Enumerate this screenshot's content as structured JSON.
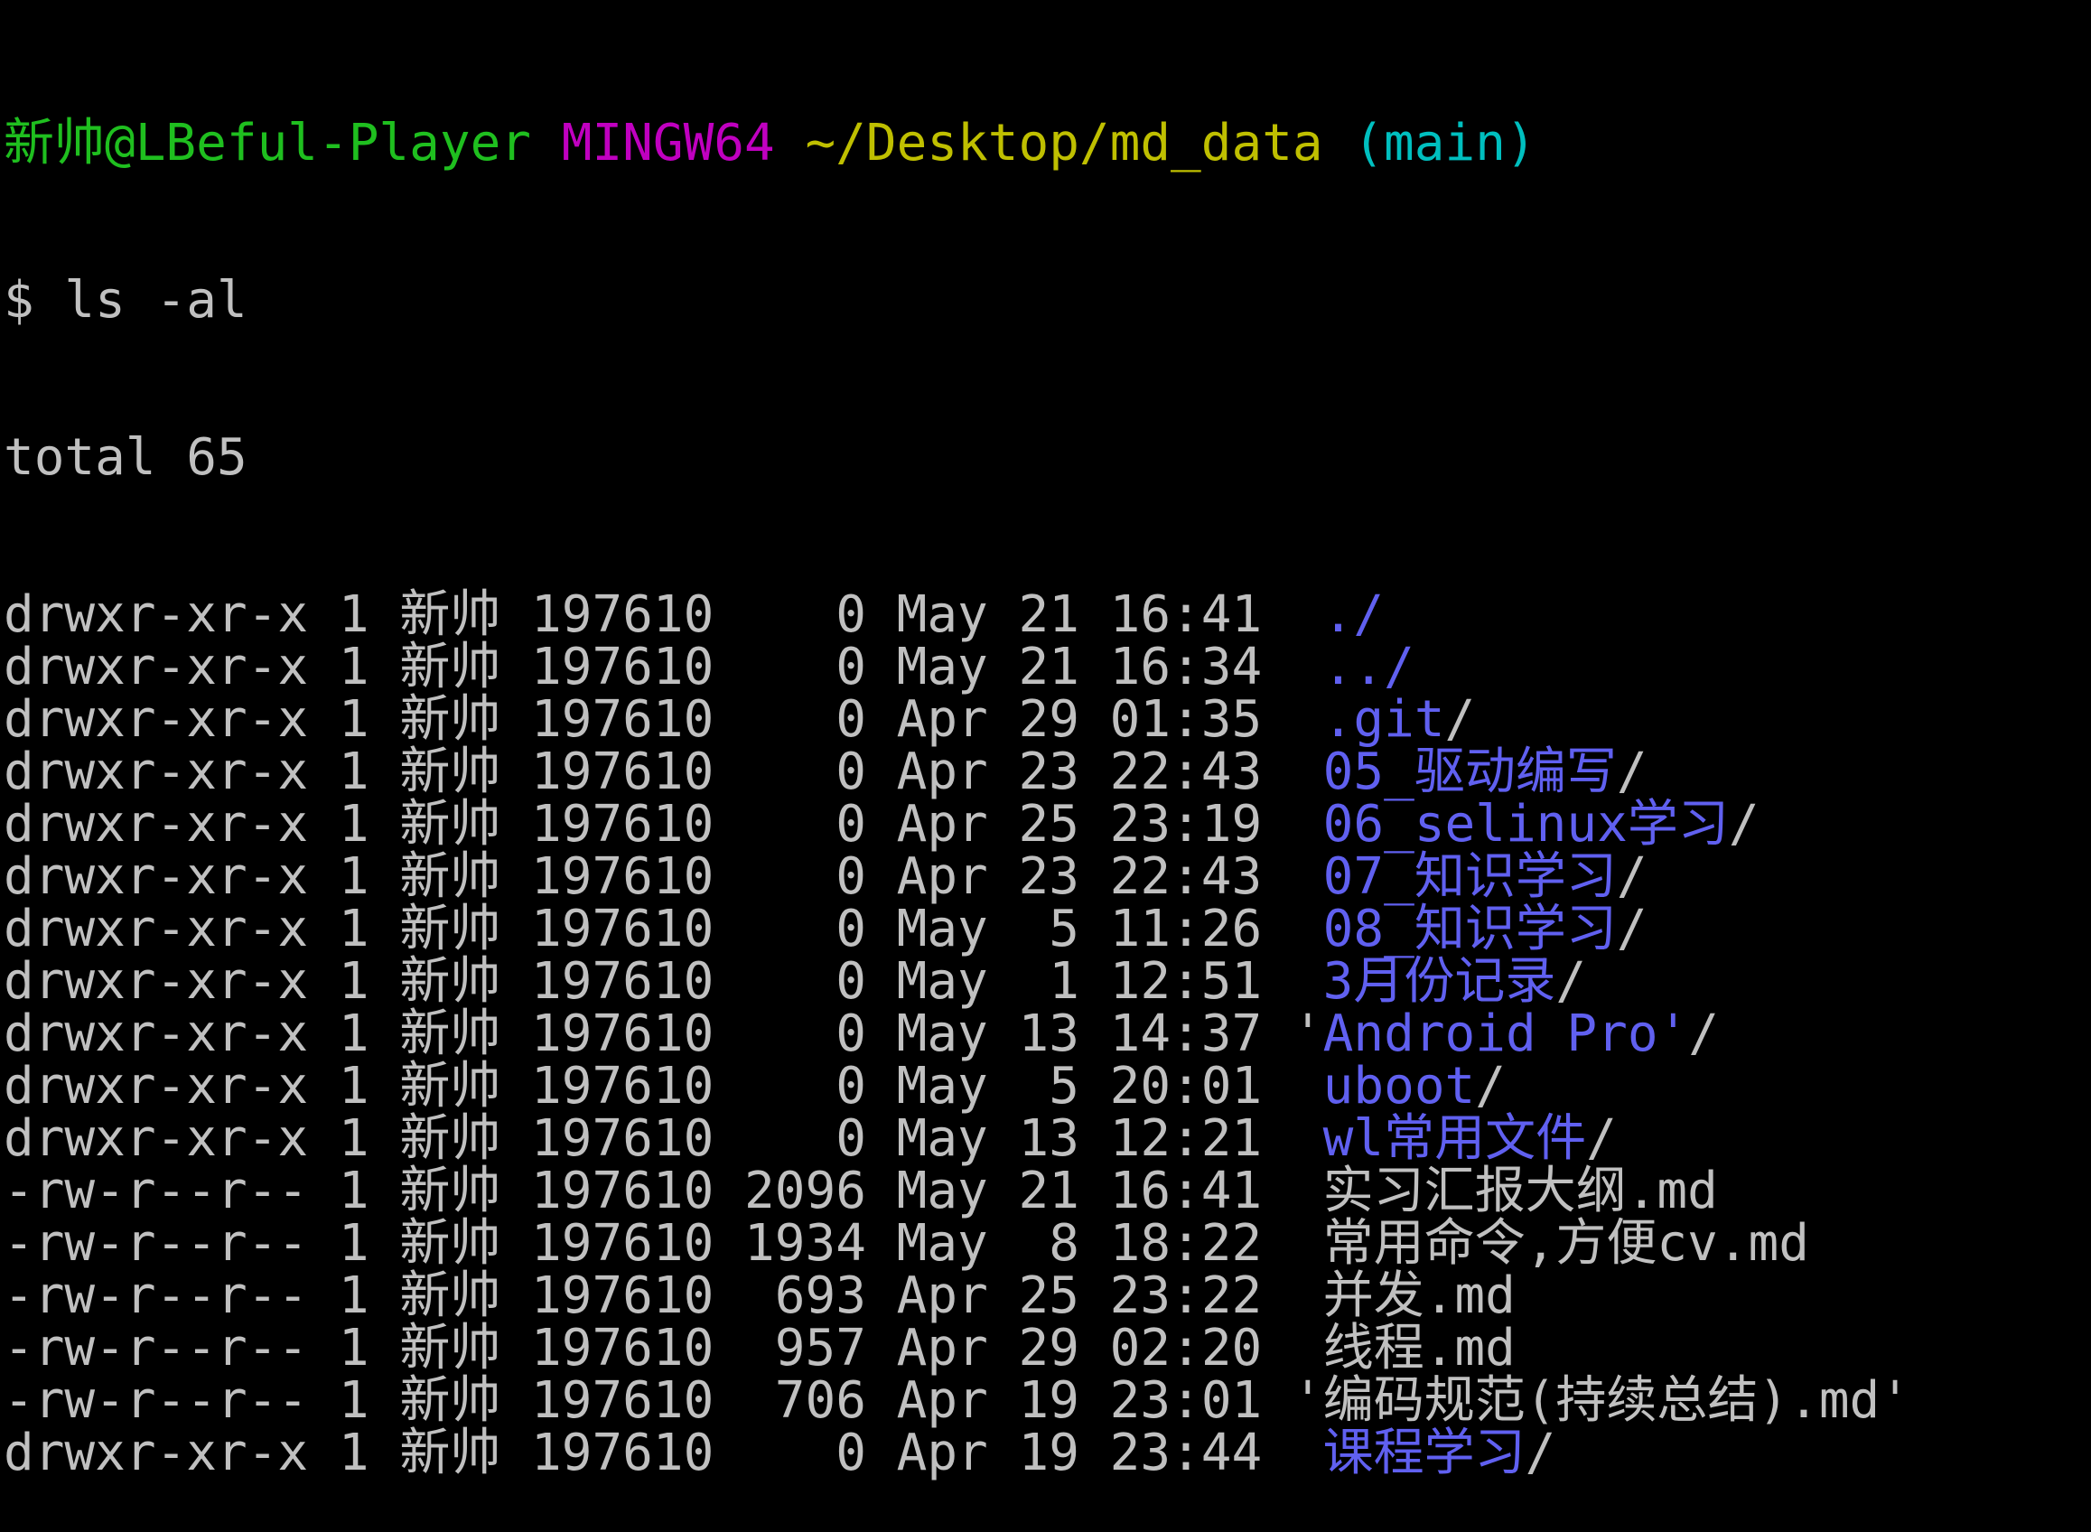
{
  "prompt": {
    "user_host": "新帅@LBeful-Player",
    "system": "MINGW64",
    "cwd": "~/Desktop/md_data",
    "branch": "(main)"
  },
  "command": "$ ls -al",
  "total": "total 65",
  "colors": {
    "background": "#000000",
    "text": "#c0c0c0",
    "user": "#1fbf1f",
    "system": "#c000c0",
    "cwd": "#bfbf00",
    "branch": "#00bfbf",
    "directory": "#6060f0"
  },
  "entries": [
    {
      "perm": "drwxr-xr-x",
      "links": "1",
      "owner": "新帅",
      "group": "197610",
      "size": "0",
      "month": "May",
      "day": "21",
      "time": "16:41",
      "qopen": " ",
      "name": "./",
      "is_dir": true,
      "qclose": ""
    },
    {
      "perm": "drwxr-xr-x",
      "links": "1",
      "owner": "新帅",
      "group": "197610",
      "size": "0",
      "month": "May",
      "day": "21",
      "time": "16:34",
      "qopen": " ",
      "name": "../",
      "is_dir": true,
      "qclose": ""
    },
    {
      "perm": "drwxr-xr-x",
      "links": "1",
      "owner": "新帅",
      "group": "197610",
      "size": "0",
      "month": "Apr",
      "day": "29",
      "time": "01:35",
      "qopen": " ",
      "name": ".git",
      "is_dir": true,
      "qclose": ""
    },
    {
      "perm": "drwxr-xr-x",
      "links": "1",
      "owner": "新帅",
      "group": "197610",
      "size": "0",
      "month": "Apr",
      "day": "23",
      "time": "22:43",
      "qopen": " ",
      "name": "05_驱动编写",
      "is_dir": true,
      "qclose": ""
    },
    {
      "perm": "drwxr-xr-x",
      "links": "1",
      "owner": "新帅",
      "group": "197610",
      "size": "0",
      "month": "Apr",
      "day": "25",
      "time": "23:19",
      "qopen": " ",
      "name": "06_selinux学习",
      "is_dir": true,
      "qclose": ""
    },
    {
      "perm": "drwxr-xr-x",
      "links": "1",
      "owner": "新帅",
      "group": "197610",
      "size": "0",
      "month": "Apr",
      "day": "23",
      "time": "22:43",
      "qopen": " ",
      "name": "07_知识学习",
      "is_dir": true,
      "qclose": ""
    },
    {
      "perm": "drwxr-xr-x",
      "links": "1",
      "owner": "新帅",
      "group": "197610",
      "size": "0",
      "month": "May",
      "day": "5",
      "time": "11:26",
      "qopen": " ",
      "name": "08_知识学习",
      "is_dir": true,
      "qclose": ""
    },
    {
      "perm": "drwxr-xr-x",
      "links": "1",
      "owner": "新帅",
      "group": "197610",
      "size": "0",
      "month": "May",
      "day": "1",
      "time": "12:51",
      "qopen": " ",
      "name": "3月份记录",
      "is_dir": true,
      "qclose": ""
    },
    {
      "perm": "drwxr-xr-x",
      "links": "1",
      "owner": "新帅",
      "group": "197610",
      "size": "0",
      "month": "May",
      "day": "13",
      "time": "14:37",
      "qopen": "'",
      "name": "Android Pro'",
      "is_dir": true,
      "qclose": ""
    },
    {
      "perm": "drwxr-xr-x",
      "links": "1",
      "owner": "新帅",
      "group": "197610",
      "size": "0",
      "month": "May",
      "day": "5",
      "time": "20:01",
      "qopen": " ",
      "name": "uboot",
      "is_dir": true,
      "qclose": ""
    },
    {
      "perm": "drwxr-xr-x",
      "links": "1",
      "owner": "新帅",
      "group": "197610",
      "size": "0",
      "month": "May",
      "day": "13",
      "time": "12:21",
      "qopen": " ",
      "name": "wl常用文件",
      "is_dir": true,
      "qclose": ""
    },
    {
      "perm": "-rw-r--r--",
      "links": "1",
      "owner": "新帅",
      "group": "197610",
      "size": "2096",
      "month": "May",
      "day": "21",
      "time": "16:41",
      "qopen": " ",
      "name": "实习汇报大纲.md",
      "is_dir": false,
      "qclose": ""
    },
    {
      "perm": "-rw-r--r--",
      "links": "1",
      "owner": "新帅",
      "group": "197610",
      "size": "1934",
      "month": "May",
      "day": "8",
      "time": "18:22",
      "qopen": " ",
      "name": "常用命令,方便cv.md",
      "is_dir": false,
      "qclose": ""
    },
    {
      "perm": "-rw-r--r--",
      "links": "1",
      "owner": "新帅",
      "group": "197610",
      "size": "693",
      "month": "Apr",
      "day": "25",
      "time": "23:22",
      "qopen": " ",
      "name": "并发.md",
      "is_dir": false,
      "qclose": ""
    },
    {
      "perm": "-rw-r--r--",
      "links": "1",
      "owner": "新帅",
      "group": "197610",
      "size": "957",
      "month": "Apr",
      "day": "29",
      "time": "02:20",
      "qopen": " ",
      "name": "线程.md",
      "is_dir": false,
      "qclose": ""
    },
    {
      "perm": "-rw-r--r--",
      "links": "1",
      "owner": "新帅",
      "group": "197610",
      "size": "706",
      "month": "Apr",
      "day": "19",
      "time": "23:01",
      "qopen": "'",
      "name": "编码规范(持续总结).md",
      "is_dir": false,
      "qclose": "'"
    },
    {
      "perm": "drwxr-xr-x",
      "links": "1",
      "owner": "新帅",
      "group": "197610",
      "size": "0",
      "month": "Apr",
      "day": "19",
      "time": "23:44",
      "qopen": " ",
      "name": "课程学习",
      "is_dir": true,
      "qclose": ""
    }
  ]
}
